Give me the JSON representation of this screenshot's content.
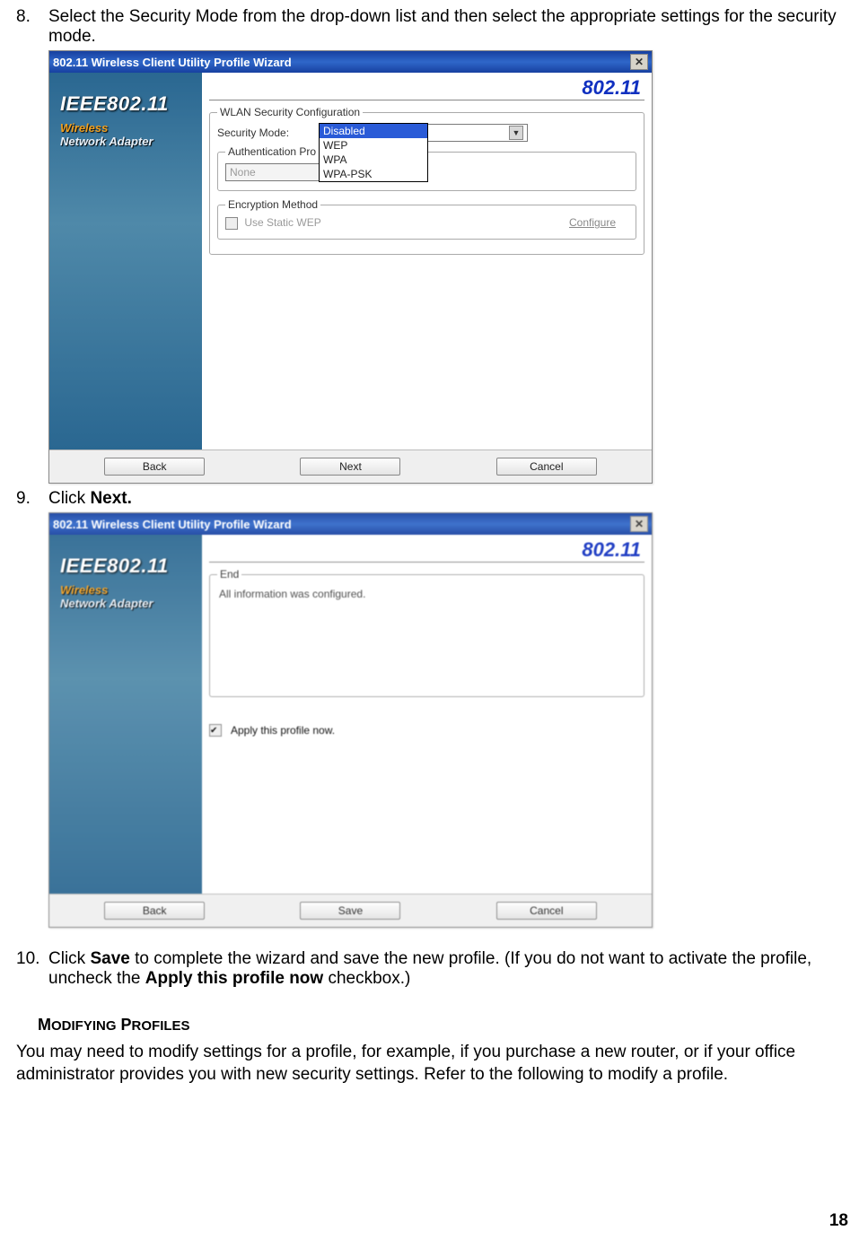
{
  "step8": {
    "num": "8.",
    "text": "Select the Security Mode from the drop-down list and then select the appropriate settings for the security mode."
  },
  "step9": {
    "num": "9.",
    "text_prefix": "Click ",
    "text_bold": "Next."
  },
  "step10": {
    "num": "10.",
    "text_prefix": "Click ",
    "bold1": "Save",
    "mid": " to complete the wizard and save the new profile. (If you do not want to activate the profile, uncheck the ",
    "bold2": "Apply this profile now",
    "suffix": " checkbox.)"
  },
  "dialog1": {
    "title": "802.11 Wireless Client Utility Profile Wizard",
    "brand_80211": "802.11",
    "side_ieee": "IEEE802.11",
    "side_wireless": "Wireless",
    "side_adapter": "Network Adapter",
    "group_wlan": "WLAN Security Configuration",
    "lbl_secmode": "Security Mode:",
    "secmode_value": "Disabled",
    "dropdown_options": [
      "Disabled",
      "WEP",
      "WPA",
      "WPA-PSK"
    ],
    "group_auth_legend": "Authentication Pro",
    "auth_value": "None",
    "group_enc_legend": "Encryption Method",
    "chk_label": "Use Static WEP",
    "configure_label": "Configure",
    "btn_back": "Back",
    "btn_next": "Next",
    "btn_cancel": "Cancel"
  },
  "dialog2": {
    "title": "802.11 Wireless Client Utility Profile  Wizard",
    "brand_80211": "802.11",
    "side_ieee": "IEEE802.11",
    "side_wireless": "Wireless",
    "side_adapter": "Network Adapter",
    "group_end": "End",
    "end_text": "All information was configured.",
    "chk_label": "Apply this profile now.",
    "btn_back": "Back",
    "btn_save": "Save",
    "btn_cancel": "Cancel"
  },
  "heading_modifying": "Modifying Profiles",
  "para_modifying": "You may need to modify settings for a profile, for example, if you purchase a new router, or if your office administrator provides you with new security settings. Refer to the following to modify a profile.",
  "page_number": "18"
}
